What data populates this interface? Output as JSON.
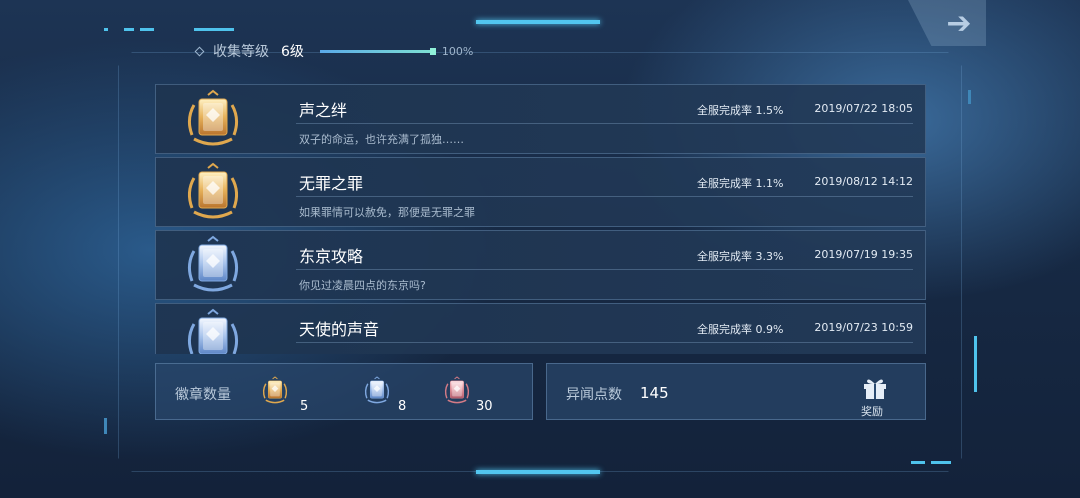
{
  "header": {
    "label": "收集等级",
    "level": "6级",
    "progress": 1.0,
    "progress_text": "100%"
  },
  "achievements": [
    {
      "title": "声之绊",
      "rate": "全服完成率 1.5%",
      "date": "2019/07/22 18:05",
      "desc": "双子的命运，也许充满了孤独……",
      "badge": "gold-badge-icon"
    },
    {
      "title": "无罪之罪",
      "rate": "全服完成率 1.1%",
      "date": "2019/08/12 14:12",
      "desc": "如果罪情可以赦免，那便是无罪之罪",
      "badge": "gold-badge-icon"
    },
    {
      "title": "东京攻略",
      "rate": "全服完成率 3.3%",
      "date": "2019/07/19 19:35",
      "desc": "你见过凌晨四点的东京吗?",
      "badge": "blue-badge-icon"
    },
    {
      "title": "天使的声音",
      "rate": "全服完成率 0.9%",
      "date": "2019/07/23 10:59",
      "desc": "",
      "badge": "blue-badge-icon"
    }
  ],
  "badges_panel": {
    "label": "徽章数量",
    "gold_count": "5",
    "blue_count": "8",
    "red_count": "30"
  },
  "points_panel": {
    "label": "异闻点数",
    "value": "145",
    "reward_label": "奖励"
  },
  "colors": {
    "accent": "#52c6ef",
    "gold": "#e0a84e",
    "blue": "#7fa8e0",
    "red": "#d47b86"
  }
}
